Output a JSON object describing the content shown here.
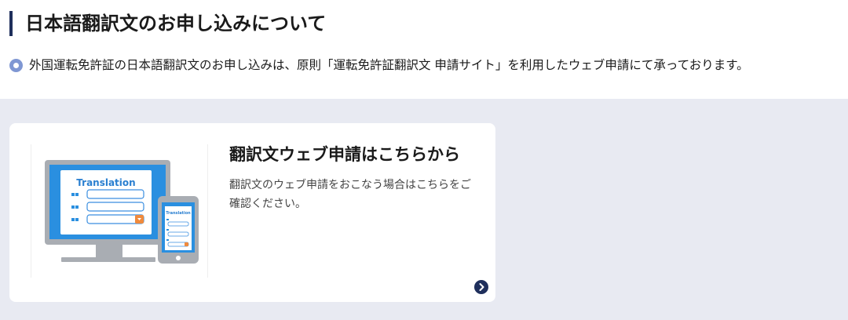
{
  "header": {
    "title": "日本語翻訳文のお申し込みについて"
  },
  "notice": {
    "text": "外国運転免許証の日本語翻訳文のお申し込みは、原則「運転免許証翻訳文 申請サイト」を利用したウェブ申請にて承っております。"
  },
  "card": {
    "title": "翻訳文ウェブ申請はこちらから",
    "description": "翻訳文のウェブ申請をおこなう場合はこちらをご確認ください。",
    "illustration": {
      "monitor_label": "Translation",
      "phone_label": "Translation"
    },
    "arrow_icon": "chevron-right-icon"
  },
  "colors": {
    "accent": "#1f2f5c",
    "bullet": "#7f97d3",
    "section_bg": "#e8eaf2",
    "illustration_blue": "#2a8fe0",
    "illustration_orange": "#f08a3c"
  }
}
